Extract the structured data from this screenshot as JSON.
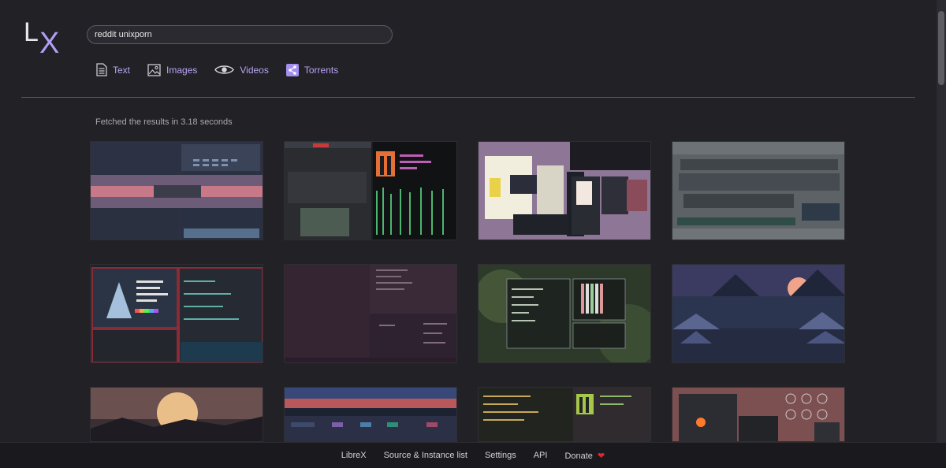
{
  "logo": {
    "l": "L",
    "x": "X"
  },
  "search": {
    "value": "reddit unixporn"
  },
  "tabs": [
    {
      "label": "Text",
      "icon": "document-icon"
    },
    {
      "label": "Images",
      "icon": "image-icon"
    },
    {
      "label": "Videos",
      "icon": "eye-icon"
    },
    {
      "label": "Torrents",
      "icon": "share-icon"
    }
  ],
  "status": {
    "fetched_text": "Fetched the results in 3.18 seconds"
  },
  "footer": {
    "links": [
      "LibreX",
      "Source & Instance list",
      "Settings",
      "API",
      "Donate"
    ],
    "heart": "❤"
  },
  "colors": {
    "background": "#212126",
    "accent": "#b39df5",
    "link": "#b9a5f4",
    "heart": "#e0272c"
  }
}
